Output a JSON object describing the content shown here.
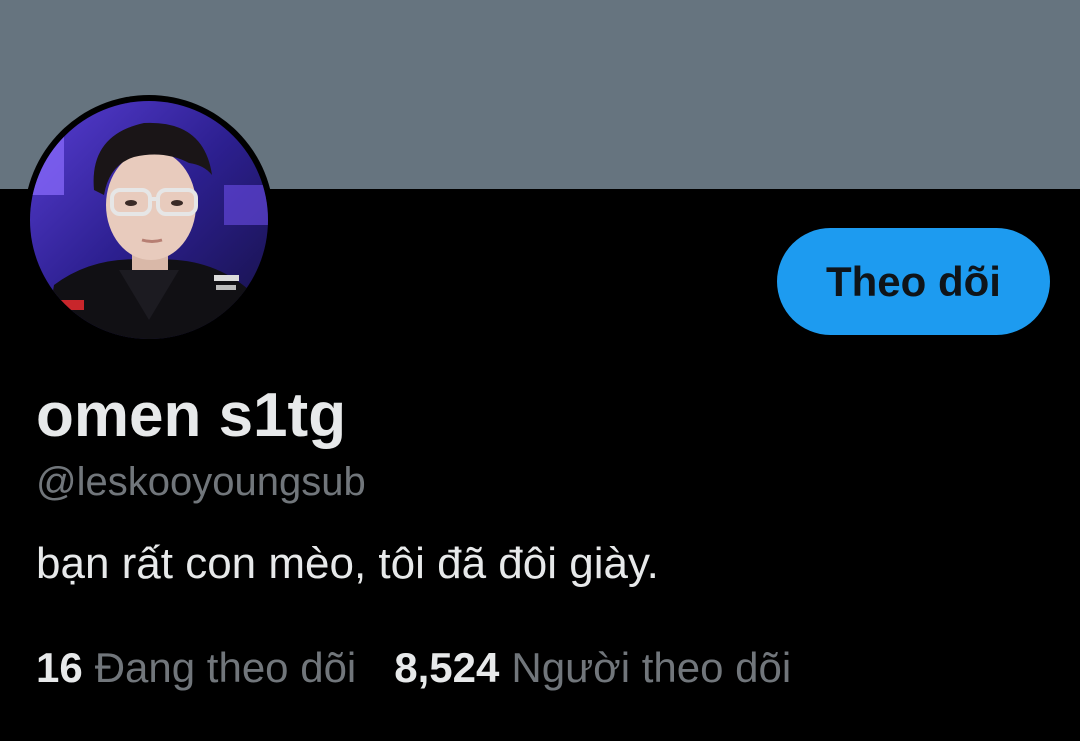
{
  "profile": {
    "display_name": "omen s1tg",
    "handle": "@leskooyoungsub",
    "bio": "bạn rất con mèo, tôi đã đôi giày.",
    "follow_button_label": "Theo dõi"
  },
  "stats": {
    "following_count": "16",
    "following_label": "Đang theo dõi",
    "followers_count": "8,524",
    "followers_label": "Người theo dõi"
  },
  "colors": {
    "banner": "#66747f",
    "background": "#000000",
    "accent": "#1d9bf0",
    "primary_text": "#e7e9ea",
    "secondary_text": "#71767b"
  }
}
